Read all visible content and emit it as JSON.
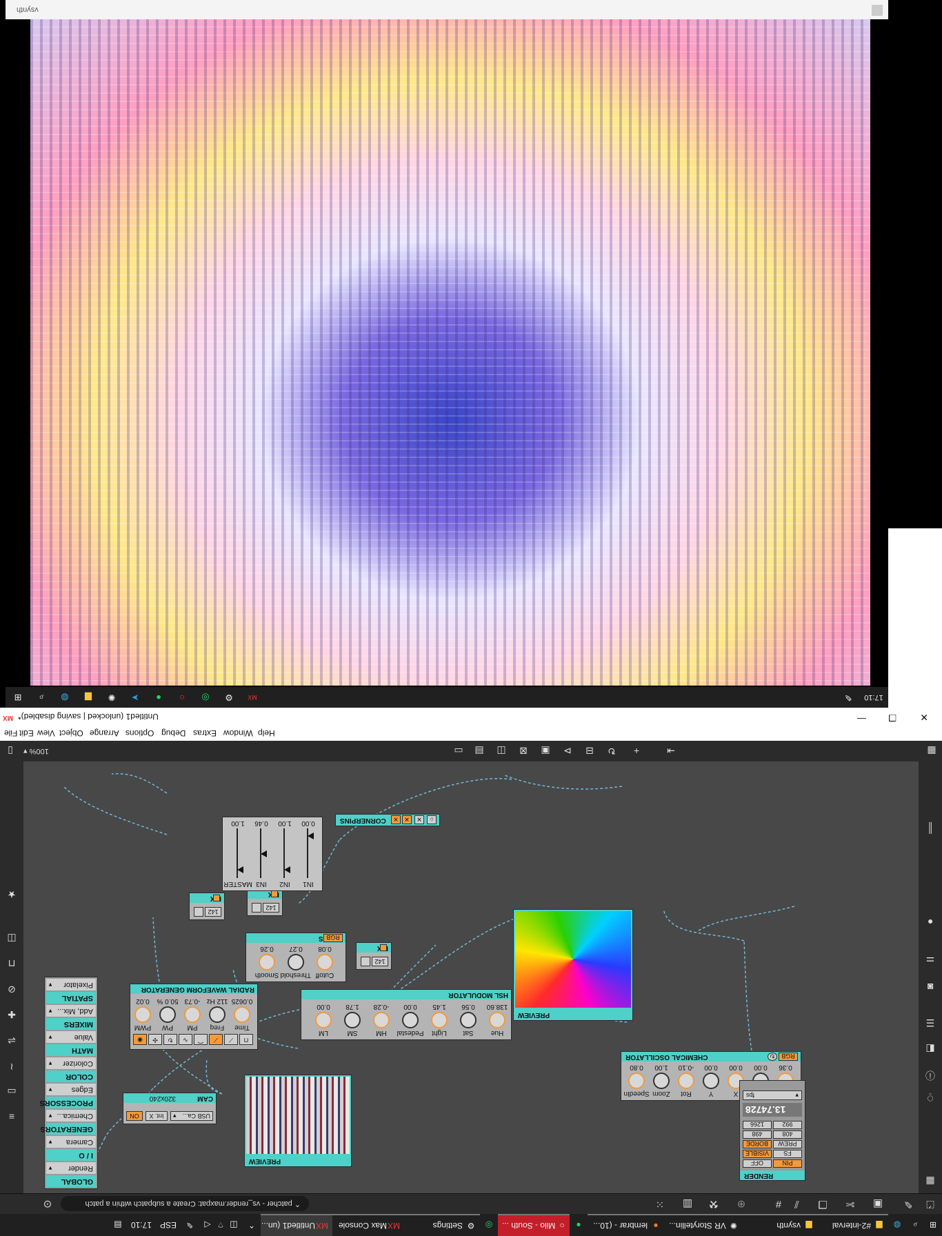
{
  "taskbar": {
    "items": [
      "#2-interval",
      "vsynth",
      "VR Storytellin...",
      "lembrar - (10...",
      "Milo - South ...",
      "Settings",
      "Max Console",
      "Untitled1 (un..."
    ],
    "clock": "17:10",
    "lang": "ESP"
  },
  "toolbar": {
    "status_message": "patcher - vs_render.maxpat: Create a subpatch within a patch"
  },
  "bottombar": {
    "zoom": "100%"
  },
  "menubar": [
    "File",
    "Edit",
    "View",
    "Object",
    "Arrange",
    "Options",
    "Debug",
    "Extras",
    "Window",
    "Help"
  ],
  "titlebar": {
    "title": "Untitled1 (unlocked | saving disabled)*"
  },
  "patch": {
    "sliders": {
      "values": [
        "0.00",
        "1.00",
        "0.46",
        "1.00"
      ],
      "labels": [
        "IN1",
        "IN2",
        "IN3",
        "MASTER"
      ],
      "levels": [
        0.85,
        0.1,
        0.46,
        0.1
      ]
    },
    "cornerpins": {
      "title": "CORNERPINS"
    },
    "pix1": {
      "title": "PIX",
      "value": "142"
    },
    "pix2": {
      "title": "PIX",
      "value": "142"
    },
    "pix3": {
      "title": "PIX",
      "value": "142"
    },
    "edges": {
      "title": "EDGES",
      "rgb": "RGB",
      "values": [
        "0.08",
        "0.27",
        "0.26"
      ],
      "labels": [
        "Cutoff",
        "Threshold",
        "Smooth"
      ]
    },
    "radial": {
      "title": "RADIAL WAVEFORM GENERATOR",
      "values": [
        "0.0625",
        "112 Hz",
        "-0.73",
        "50.0 %",
        "0.02"
      ],
      "labels": [
        "Time",
        "Freq",
        "PM",
        "PW",
        "PWM"
      ]
    },
    "hsl": {
      "title": "HSL MODULATOR",
      "values": [
        "138.60",
        "0.56",
        "1.45",
        "0.00",
        "-0.28",
        "1.78",
        "0.00"
      ],
      "labels": [
        "Hue",
        "Sat",
        "Light",
        "Pedestal",
        "HM",
        "SM",
        "LM"
      ]
    },
    "chem": {
      "title": "CHEMICAL OSCILLATOR",
      "rgb": "RGB",
      "values": [
        "0.36",
        "0.00",
        "0.00",
        "0.00",
        "-0.10",
        "1.00",
        "0.80"
      ],
      "labels": [
        "Speed",
        "Distrib",
        "X",
        "Y",
        "Rot",
        "Zoom",
        "SpeedIn"
      ]
    },
    "preview_chem": {
      "title": "PREVIEW"
    },
    "preview_cam": {
      "title": "PREVIEW"
    },
    "cam": {
      "title": "CAM",
      "on": "ON",
      "int": "Int. X",
      "device": "USB Ca...",
      "resolution": "320x240"
    },
    "render": {
      "title": "RENDER",
      "fps_label": "fps",
      "fps_value": "13.74728",
      "w": "1266",
      "h": "992",
      "w2": "498",
      "h2": "408",
      "border": "BORDE",
      "prew": "PREW",
      "visible": "VISIBLE",
      "fs": "FS",
      "off": "OFF",
      "pin": "PIN"
    },
    "menu": [
      {
        "label": "GLOBAL",
        "type": "hdr"
      },
      {
        "label": "Render",
        "type": "sel"
      },
      {
        "label": "I / O",
        "type": "hdr"
      },
      {
        "label": "Camera",
        "type": "sel"
      },
      {
        "label": "GENERATORS",
        "type": "hdr"
      },
      {
        "label": "Chemica...",
        "type": "sel"
      },
      {
        "label": "PROCESSORS",
        "type": "hdr"
      },
      {
        "label": "Edges",
        "type": "sel"
      },
      {
        "label": "COLOR",
        "type": "hdr"
      },
      {
        "label": "Colorizer",
        "type": "sel"
      },
      {
        "label": "MATH",
        "type": "hdr"
      },
      {
        "label": "Value",
        "type": "sel"
      },
      {
        "label": "MIXERS",
        "type": "hdr"
      },
      {
        "label": "Add, Mix...",
        "type": "sel"
      },
      {
        "label": "SPATIAL",
        "type": "hdr"
      },
      {
        "label": "Pixelator",
        "type": "sel"
      }
    ]
  },
  "win2": {
    "clock": "17:10",
    "status": "vsynth"
  },
  "colors": {
    "teal": "#4fd0c8",
    "orange": "#f39a3c",
    "canvas": "#484848"
  }
}
